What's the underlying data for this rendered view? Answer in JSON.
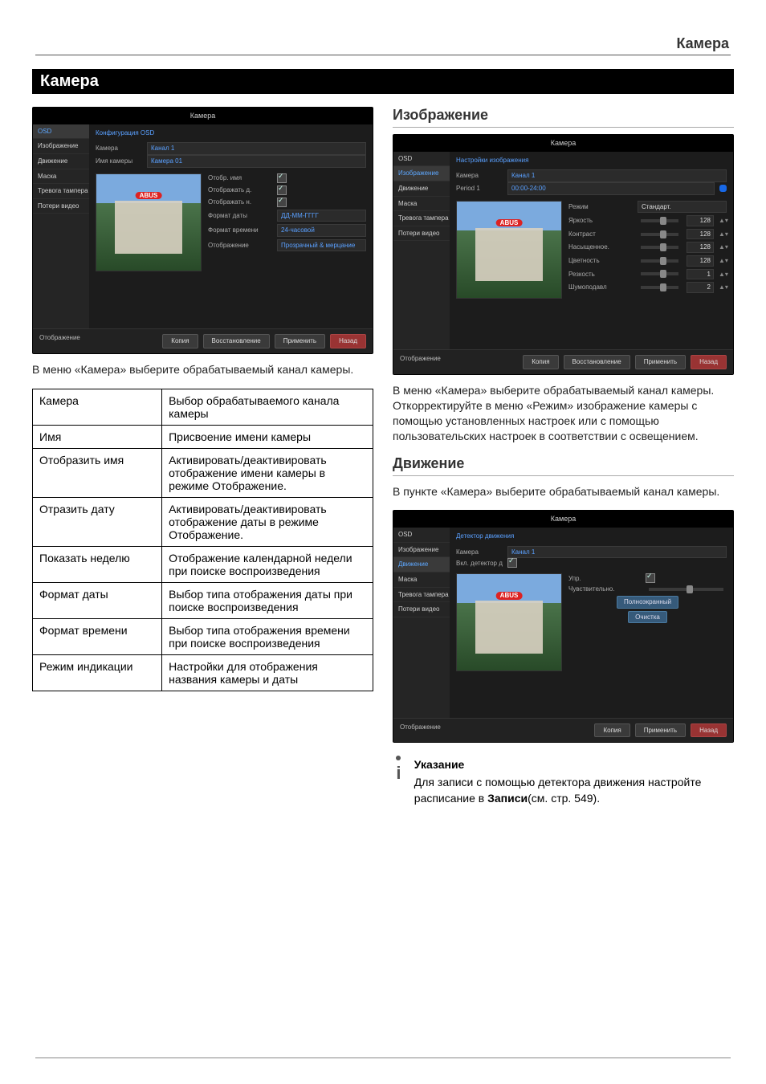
{
  "header": {
    "section_right": "Камера"
  },
  "section_title": "Камера",
  "left": {
    "intro": "В меню «Камера» выберите обрабатываемый канал камеры.",
    "table": [
      {
        "k": "Камера",
        "v": "Выбор обрабатываемого канала камеры"
      },
      {
        "k": "Имя",
        "v": "Присвоение имени камеры"
      },
      {
        "k": "Отобразить имя",
        "v": "Активировать/деактивировать отображение имени камеры в режиме Отображение."
      },
      {
        "k": "Отразить дату",
        "v": "Активировать/деактивировать отображение даты в режиме Отображение."
      },
      {
        "k": "Показать неделю",
        "v": "Отображение календарной недели при поиске воспроизведения"
      },
      {
        "k": "Формат даты",
        "v": "Выбор типа отображения даты при поиске воспроизведения"
      },
      {
        "k": "Формат времени",
        "v": "Выбор типа отображения времени при поиске воспроизведения"
      },
      {
        "k": "Режим индикации",
        "v": "Настройки для отображения названия камеры и даты"
      }
    ]
  },
  "right": {
    "image_heading": "Изображение",
    "image_text": "В меню «Камера» выберите обрабатываемый канал камеры.\nОткорректируйте в меню «Режим» изображение камеры с помощью установленных настроек или с помощью пользовательских настроек в соответствии с освещением.",
    "motion_heading": "Движение",
    "motion_text": "В пункте «Камера» выберите обрабатываемый канал камеры.",
    "note_title": "Указание",
    "note_text_1": "Для записи с помощью детектора движения настройте расписание в ",
    "note_bold": "Записи",
    "note_text_2": "(см. стр. 549)."
  },
  "shots": {
    "common": {
      "title": "Камера",
      "sidebar": [
        "OSD",
        "Изображение",
        "Движение",
        "Маска",
        "Тревога тампера",
        "Потери видео"
      ],
      "foot_left": "Отображение",
      "btn_copy": "Копия",
      "btn_restore": "Восстановление",
      "btn_apply": "Применить",
      "btn_back": "Назад",
      "logo": "ABUS"
    },
    "osd": {
      "active_index": 0,
      "crumbs": "Конфигурация OSD",
      "rows_top": [
        {
          "label": "Камера",
          "value": "Канал 1"
        },
        {
          "label": "Имя камеры",
          "value": "Камера 01"
        }
      ],
      "params": [
        {
          "label": "Отобр. имя",
          "type": "chk"
        },
        {
          "label": "Отображать д.",
          "type": "chk"
        },
        {
          "label": "Отображать н.",
          "type": "chk"
        },
        {
          "label": "Формат даты",
          "type": "val",
          "value": "ДД-ММ-ГГГГ"
        },
        {
          "label": "Формат времени",
          "type": "val",
          "value": "24-часовой"
        },
        {
          "label": "Отображение",
          "type": "val",
          "value": "Прозрачный & мерцание"
        }
      ]
    },
    "image": {
      "active_index": 1,
      "crumbs": "Настройки изображения",
      "rows_top": [
        {
          "label": "Камера",
          "value": "Канал 1"
        },
        {
          "label": "Period 1",
          "value": "00:00-24:00",
          "dot": true
        }
      ],
      "mode_label": "Режим",
      "mode_value": "Стандарт.",
      "sliders": [
        {
          "label": "Яркость",
          "n": "128"
        },
        {
          "label": "Контраст",
          "n": "128"
        },
        {
          "label": "Насыщенное.",
          "n": "128"
        },
        {
          "label": "Цветность",
          "n": "128"
        },
        {
          "label": "Резкость",
          "n": "1"
        },
        {
          "label": "Шумоподавл",
          "n": "2"
        }
      ]
    },
    "motion": {
      "active_index": 2,
      "crumbs": "Детектор движения",
      "rows_top": [
        {
          "label": "Камера",
          "value": "Канал 1"
        },
        {
          "label": "Вкл. детектор движения",
          "type": "chk"
        }
      ],
      "side_params": [
        {
          "label": "Упр.",
          "chk": true
        },
        {
          "label": "Чувствительно."
        }
      ],
      "buttons": [
        "Полноэкранный",
        "Очистка"
      ]
    }
  }
}
